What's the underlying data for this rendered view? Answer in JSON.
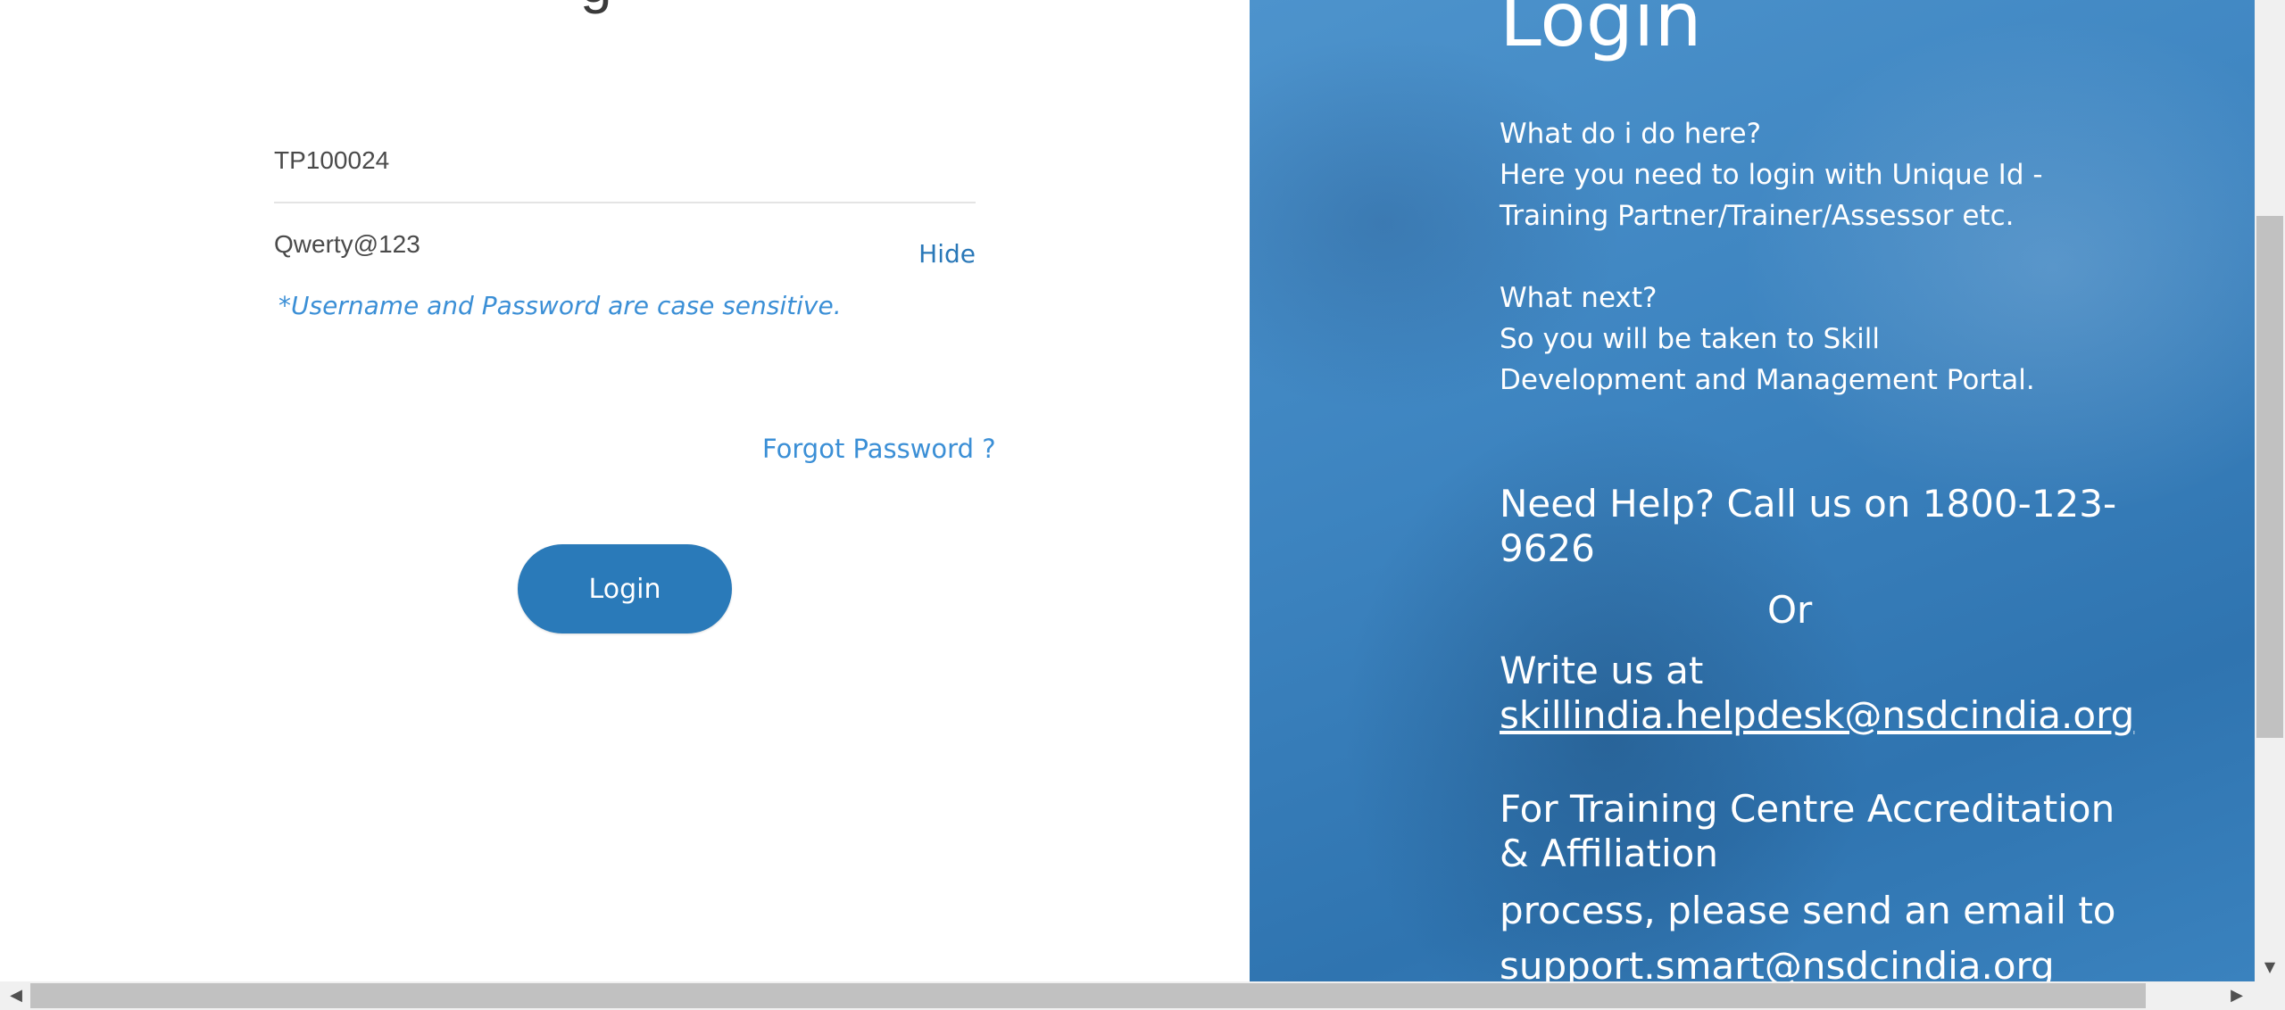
{
  "form": {
    "heading_fragment": "g",
    "username_value": "TP100024",
    "password_value": "Qwerty@123",
    "hide_label": "Hide",
    "case_hint": "*Username and Password are case sensitive.",
    "forgot_label": "Forgot Password ?",
    "login_button_label": "Login"
  },
  "info": {
    "title": "Login",
    "question1": "What do i do here?",
    "answer1": "Here you need to login with Unique Id - Training Partner/Trainer/Assessor etc.",
    "question2": "What next?",
    "answer2": "So you will be taken to Skill Development and Management Portal.",
    "help_text": "Need Help? Call us on 1800-123-9626",
    "or_text": "Or",
    "write_text": "Write us at",
    "helpdesk_email": "skillindia.helpdesk@nsdcindia.org",
    "tc_text": "For Training Centre Accreditation & Affiliation",
    "process_text": "process, please send an email to",
    "support_email": "support.smart@nsdcindia.org"
  },
  "scrollbars": {
    "arrow_left": "◀",
    "arrow_right": "▶",
    "arrow_down": "▼"
  },
  "colors": {
    "brand_blue": "#2a7ab9",
    "link_blue": "#3b8fd6",
    "panel_blue": "#3d84c0"
  }
}
